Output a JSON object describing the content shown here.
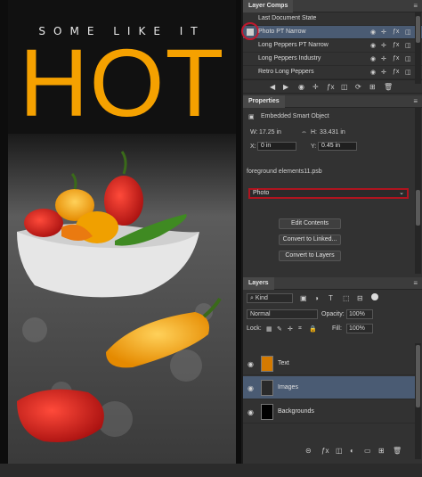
{
  "artwork": {
    "tagline": "SOME LIKE IT",
    "headline": "HOT"
  },
  "layer_comps": {
    "tab_label": "Layer Comps",
    "rows": [
      {
        "label": "Last Document State"
      },
      {
        "label": "Photo PT Narrow"
      },
      {
        "label": "Long Peppers PT Narrow"
      },
      {
        "label": "Long Peppers Industry"
      },
      {
        "label": "Retro Long Peppers"
      }
    ],
    "row_icons": {
      "visibility": "eye-icon",
      "position": "move-icon",
      "effects": "fx-icon"
    }
  },
  "properties": {
    "tab_label": "Properties",
    "object_type": "Embedded Smart Object",
    "w_label": "W:",
    "w_value": "17.25 in",
    "h_label": "H:",
    "h_value": "33.431 in",
    "x_label": "X:",
    "x_value": "0 in",
    "y_label": "Y:",
    "y_value": "0.45 in",
    "file_name": "foreground elements11.psb",
    "comp_select": "Photo",
    "buttons": {
      "edit": "Edit Contents",
      "linked": "Convert to Linked...",
      "layers": "Convert to Layers"
    }
  },
  "layers_panel": {
    "tab_label": "Layers",
    "filter": "Kind",
    "blend_mode": "Normal",
    "opacity_label": "Opacity:",
    "opacity_value": "100%",
    "lock_label": "Lock:",
    "fill_label": "Fill:",
    "fill_value": "100%",
    "layers": [
      {
        "name": "Text"
      },
      {
        "name": "Images"
      },
      {
        "name": "Backgrounds"
      }
    ]
  },
  "colors": {
    "accent_orange": "#f5a100",
    "selection_blue": "#4a5b73",
    "highlight_red": "#c0182e"
  }
}
